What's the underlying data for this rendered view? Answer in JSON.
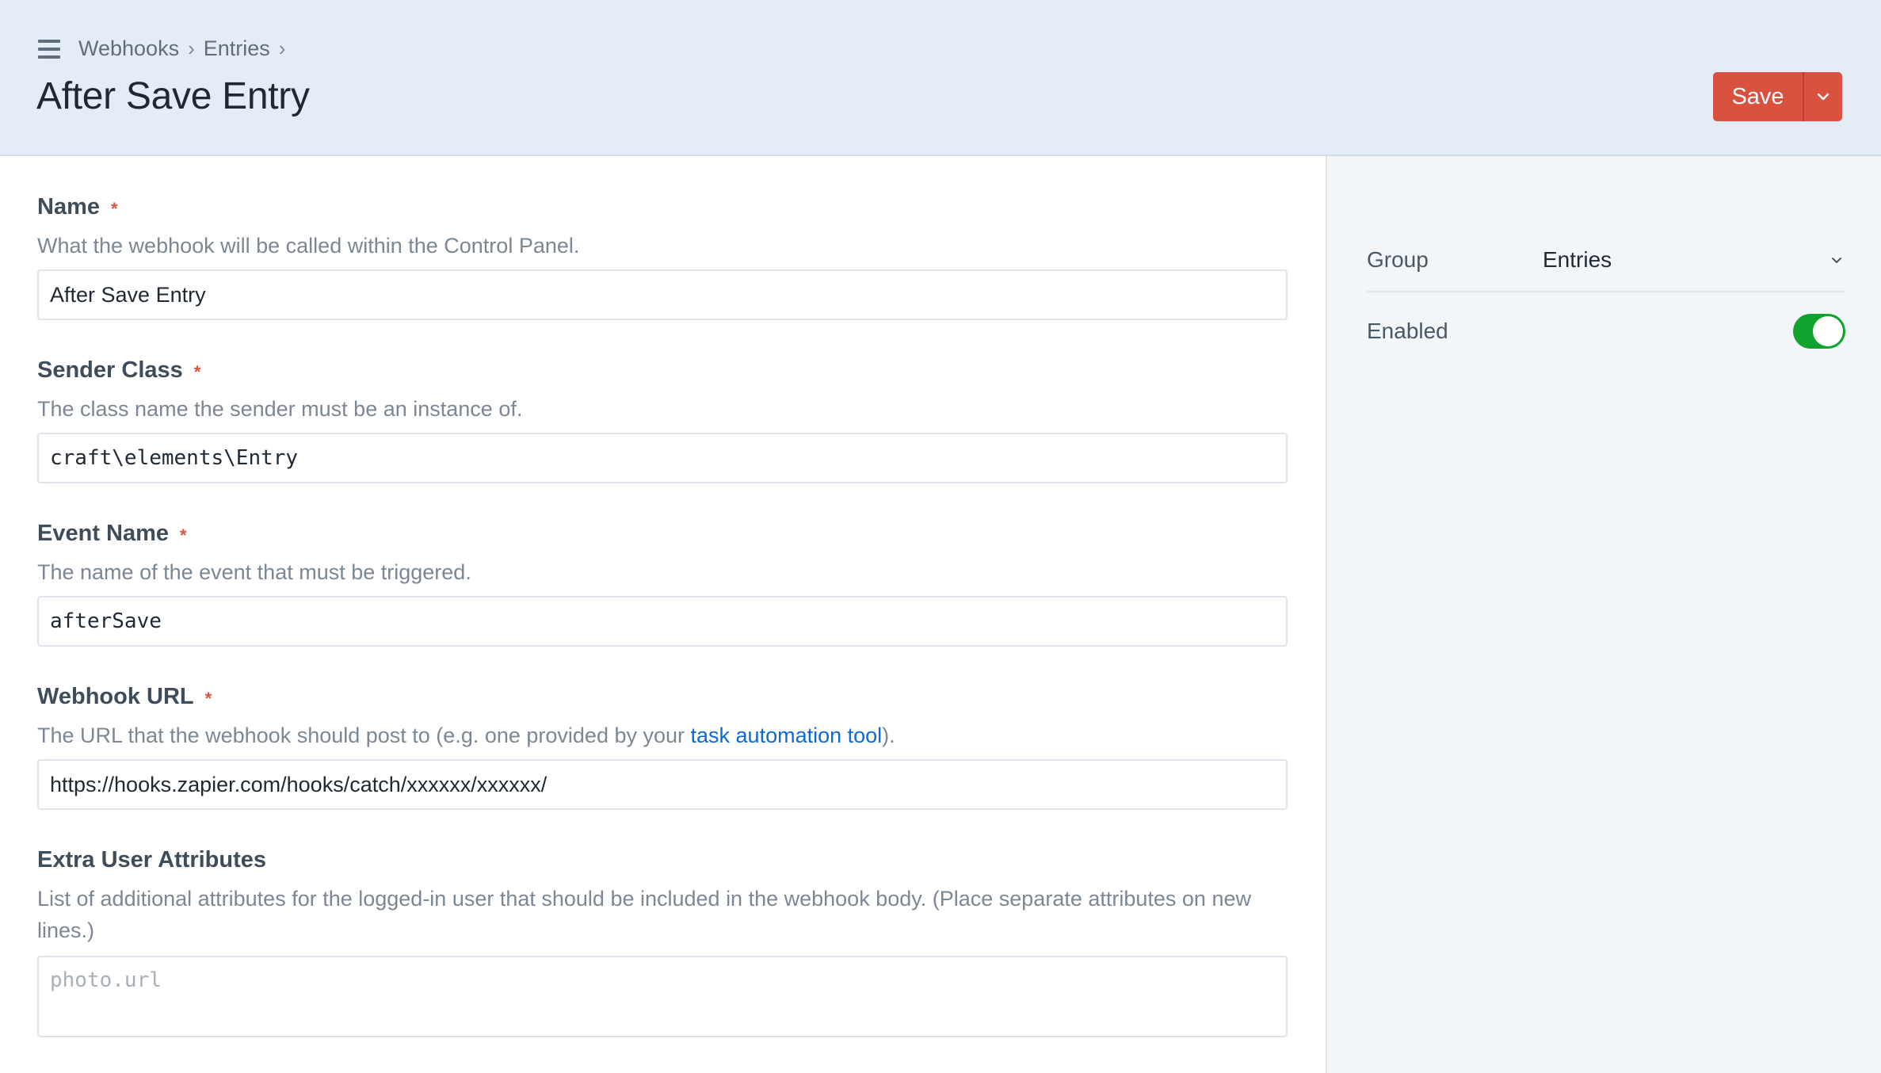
{
  "breadcrumb": {
    "items": [
      "Webhooks",
      "Entries"
    ],
    "separator": "›"
  },
  "header": {
    "title": "After Save Entry",
    "save_label": "Save",
    "save_color": "#d9513f"
  },
  "fields": {
    "name": {
      "label": "Name",
      "required_mark": "*",
      "instructions": "What the webhook will be called within the Control Panel.",
      "value": "After Save Entry"
    },
    "sender_class": {
      "label": "Sender Class",
      "required_mark": "*",
      "instructions": "The class name the sender must be an instance of.",
      "value": "craft\\elements\\Entry"
    },
    "event_name": {
      "label": "Event Name",
      "required_mark": "*",
      "instructions": "The name of the event that must be triggered.",
      "value": "afterSave"
    },
    "webhook_url": {
      "label": "Webhook URL",
      "required_mark": "*",
      "instructions_before": "The URL that the webhook should post to (e.g. one provided by your ",
      "instructions_link": "task automation tool",
      "instructions_after": ").",
      "value": "https://hooks.zapier.com/hooks/catch/xxxxxx/xxxxxx/"
    },
    "extra_user_attributes": {
      "label": "Extra User Attributes",
      "instructions": "List of additional attributes for the logged-in user that should be included in the webhook body. (Place separate attributes on new lines.)",
      "placeholder": "photo.url",
      "value": ""
    }
  },
  "sidebar": {
    "group_label": "Group",
    "group_value": "Entries",
    "enabled_label": "Enabled",
    "enabled": true,
    "toggle_color": "#10a32d"
  },
  "icons": {
    "menu": "hamburger-icon",
    "save_menu": "chevron-down-icon",
    "group_select": "chevron-down-icon"
  }
}
